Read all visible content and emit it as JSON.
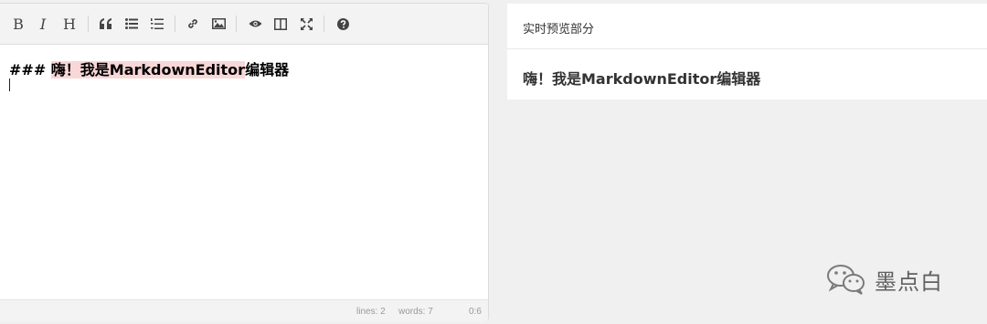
{
  "toolbar": {
    "bold_label": "B",
    "italic_label": "I",
    "heading_label": "H",
    "buttons": [
      "bold-icon",
      "italic-icon",
      "heading-icon",
      "quote-icon",
      "unordered-list-icon",
      "ordered-list-icon",
      "link-icon",
      "image-icon",
      "preview-eye-icon",
      "side-by-side-icon",
      "fullscreen-icon",
      "help-icon"
    ]
  },
  "editor": {
    "prefix": "### ",
    "heading_text": "嗨！我是MarkdownEditor",
    "suffix": "编辑器"
  },
  "statusbar": {
    "lines": "lines: 2",
    "words": "words: 7",
    "cursor": "0:6"
  },
  "preview": {
    "title": "实时预览部分",
    "heading": "嗨！我是MarkdownEditor编辑器"
  },
  "watermark": {
    "text": "墨点白",
    "icon": "wechat-icon"
  },
  "colors": {
    "heading_highlight": "#f9d7d7",
    "toolbar_bg": "#f3f3f3",
    "page_bg": "#f0f0f0"
  }
}
